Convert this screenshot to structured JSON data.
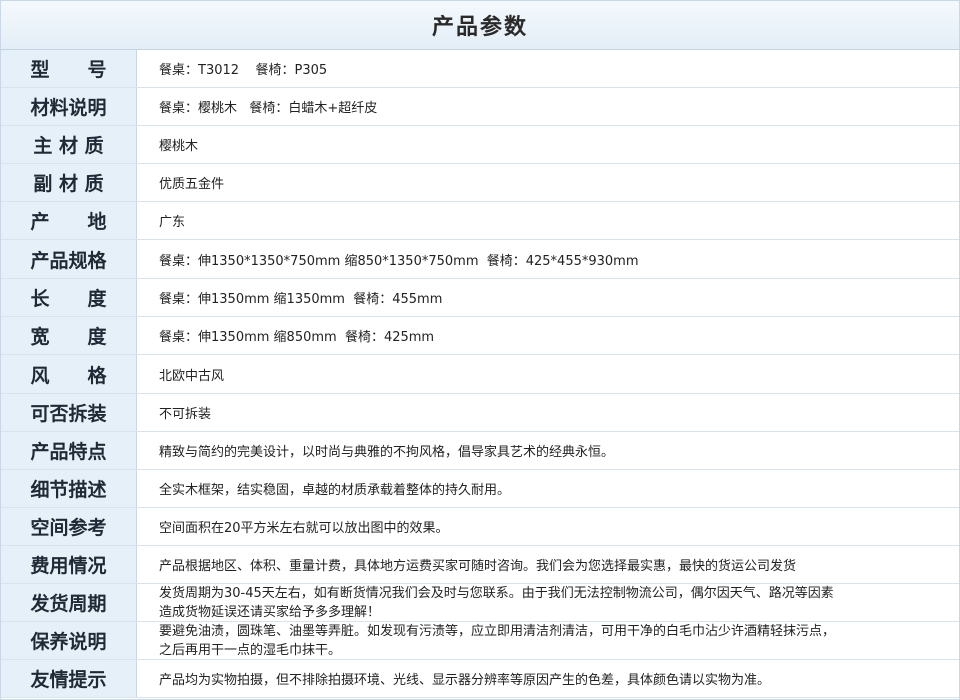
{
  "title": "产品参数",
  "rows": [
    {
      "label": "型　　号",
      "value": "餐桌：T3012    餐椅：P305"
    },
    {
      "label": "材料说明",
      "value": "餐桌：樱桃木   餐椅：白蜡木+超纤皮"
    },
    {
      "label": "主 材 质",
      "value": "樱桃木"
    },
    {
      "label": "副 材 质",
      "value": "优质五金件"
    },
    {
      "label": "产　　地",
      "value": "广东"
    },
    {
      "label": "产品规格",
      "value": "餐桌：伸1350*1350*750mm 缩850*1350*750mm  餐椅：425*455*930mm"
    },
    {
      "label": "长　　度",
      "value": "餐桌：伸1350mm 缩1350mm  餐椅：455mm"
    },
    {
      "label": "宽　　度",
      "value": "餐桌：伸1350mm 缩850mm  餐椅：425mm"
    },
    {
      "label": "风　　格",
      "value": "北欧中古风"
    },
    {
      "label": "可否拆装",
      "value": "不可拆装"
    },
    {
      "label": "产品特点",
      "value": "精致与简约的完美设计，以时尚与典雅的不拘风格，倡导家具艺术的经典永恒。"
    },
    {
      "label": "细节描述",
      "value": "全实木框架，结实稳固，卓越的材质承载着整体的持久耐用。"
    },
    {
      "label": "空间参考",
      "value": "空间面积在20平方米左右就可以放出图中的效果。"
    },
    {
      "label": "费用情况",
      "value": "产品根据地区、体积、重量计费，具体地方运费买家可随时咨询。我们会为您选择最实惠，最快的货运公司发货"
    },
    {
      "label": "发货周期",
      "value": "发货周期为30-45天左右，如有断货情况我们会及时与您联系。由于我们无法控制物流公司，偶尔因天气、路况等因素\n造成货物延误还请买家给予多多理解！"
    },
    {
      "label": "保养说明",
      "value": "要避免油渍，圆珠笔、油墨等弄脏。如发现有污渍等，应立即用清洁剂清洁，可用干净的白毛巾沾少许酒精轻抹污点，\n之后再用干一点的湿毛巾抹干。"
    },
    {
      "label": "友情提示",
      "value": "产品均为实物拍摄，但不排除拍摄环境、光线、显示器分辨率等原因产生的色差，具体颜色请以实物为准。"
    }
  ]
}
